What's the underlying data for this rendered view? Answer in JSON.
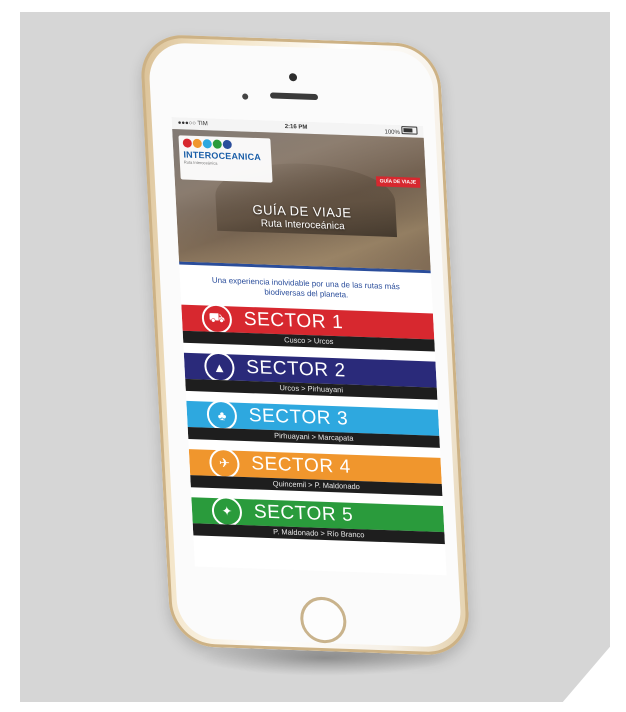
{
  "statusbar": {
    "carrier": "●●●○○ TIM",
    "time": "2:16 PM",
    "battery_text": "100%"
  },
  "logo": {
    "name": "INTEROCEANICA",
    "tagline": "Ruta Interoceánica",
    "dot_colors": [
      "#d7282f",
      "#f0962d",
      "#2ea8df",
      "#2a9b3c",
      "#2a4d9b"
    ]
  },
  "hero": {
    "badge": "GUÍA DE VIAJE",
    "title": "GUÍA DE VIAJE",
    "subtitle": "Ruta Interoceánica"
  },
  "intro": "Una experiencia inolvidable por una de las rutas más biodiversas del planeta.",
  "sectors": [
    {
      "label": "SECTOR 1",
      "route": "Cusco > Urcos",
      "color": "#d7282f",
      "icon": "road-icon",
      "glyph": "⛟"
    },
    {
      "label": "SECTOR 2",
      "route": "Urcos > Pirhuayani",
      "color": "#2a2a7a",
      "icon": "mountain-icon",
      "glyph": "▲"
    },
    {
      "label": "SECTOR 3",
      "route": "Pirhuayani > Marcapata",
      "color": "#2ea8df",
      "icon": "tree-icon",
      "glyph": "♣"
    },
    {
      "label": "SECTOR 4",
      "route": "Quincemil > P. Maldonado",
      "color": "#f0962d",
      "icon": "bird-icon",
      "glyph": "✈"
    },
    {
      "label": "SECTOR 5",
      "route": "P. Maldonado > Río Branco",
      "color": "#2a9b3c",
      "icon": "heron-icon",
      "glyph": "✦"
    }
  ]
}
